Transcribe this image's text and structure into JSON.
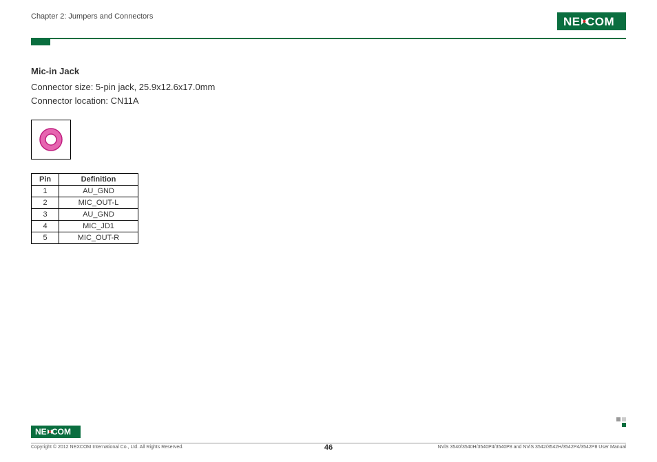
{
  "header": {
    "chapter": "Chapter 2: Jumpers and Connectors",
    "logo_text": "NEXCOM"
  },
  "section": {
    "title": "Mic-in Jack",
    "size_label": "Connector size: 5-pin jack, 25.9x12.6x17.0mm",
    "location_label": "Connector location: CN11A"
  },
  "table": {
    "headers": {
      "pin": "Pin",
      "definition": "Definition"
    },
    "rows": [
      {
        "pin": "1",
        "definition": "AU_GND"
      },
      {
        "pin": "2",
        "definition": "MIC_OUT-L"
      },
      {
        "pin": "3",
        "definition": "AU_GND"
      },
      {
        "pin": "4",
        "definition": "MIC_JD1"
      },
      {
        "pin": "5",
        "definition": "MIC_OUT-R"
      }
    ]
  },
  "footer": {
    "copyright": "Copyright © 2012 NEXCOM International Co., Ltd. All Rights Reserved.",
    "page": "46",
    "manual": "NViS 3540/3540H/3540P4/3540P8 and NViS 3542/3542H/3542P4/3542P8 User Manual"
  },
  "colors": {
    "brand_green": "#0a6e3f",
    "jack_pink": "#e665b0"
  }
}
